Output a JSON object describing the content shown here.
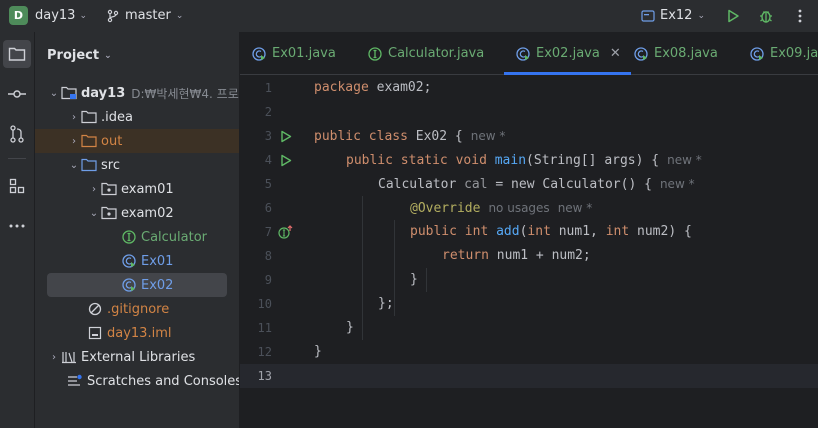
{
  "titlebar": {
    "project_initial": "D",
    "project_name": "day13",
    "branch": "master",
    "run_config": "Ex12"
  },
  "project_panel": {
    "title": "Project",
    "tree": [
      {
        "label": "day13",
        "path": "D:₩박세현₩4. 프로"
      },
      {
        "label": ".idea"
      },
      {
        "label": "out"
      },
      {
        "label": "src"
      },
      {
        "label": "exam01"
      },
      {
        "label": "exam02"
      },
      {
        "label": "Calculator"
      },
      {
        "label": "Ex01"
      },
      {
        "label": "Ex02"
      },
      {
        "label": ".gitignore"
      },
      {
        "label": "day13.iml"
      },
      {
        "label": "External Libraries"
      },
      {
        "label": "Scratches and Consoles"
      }
    ]
  },
  "tabs": [
    {
      "label": "Ex01.java"
    },
    {
      "label": "Calculator.java"
    },
    {
      "label": "Ex02.java"
    },
    {
      "label": "Ex08.java"
    },
    {
      "label": "Ex09.java"
    }
  ],
  "editor": {
    "line_numbers": [
      "1",
      "2",
      "3",
      "4",
      "5",
      "6",
      "7",
      "8",
      "9",
      "10",
      "11",
      "12",
      "13"
    ],
    "hints": {
      "new": "new *",
      "no_usages": "no usages"
    },
    "code": {
      "l1_kw": "package",
      "l1_rest": " exam02;",
      "l3_kw1": "public",
      "l3_kw2": "class",
      "l3_rest": " Ex02 {",
      "l4_kw1": "public",
      "l4_kw2": "static",
      "l4_kw3": "void",
      "l4_fn": "main",
      "l4_rest": "(String[] args) {",
      "l5_a": "Calculator ",
      "l5_var": "cal",
      "l5_b": " = new Calculator() {",
      "l6_an": "@Override",
      "l7_kw1": "public",
      "l7_kw2": "int",
      "l7_fn": "add",
      "l7_p1": "(",
      "l7_kw3": "int",
      "l7_p2": " num1, ",
      "l7_kw4": "int",
      "l7_p3": " num2) {",
      "l8_kw": "return",
      "l8_rest": " num1 + num2;",
      "l9": "}",
      "l10": "};",
      "l11": "}",
      "l12": "}"
    }
  },
  "colors": {
    "accent": "#3574f0",
    "run_green": "#5fb865",
    "keyword": "#cf8e6d",
    "function": "#56a8f5",
    "annotation": "#b3ae60"
  }
}
